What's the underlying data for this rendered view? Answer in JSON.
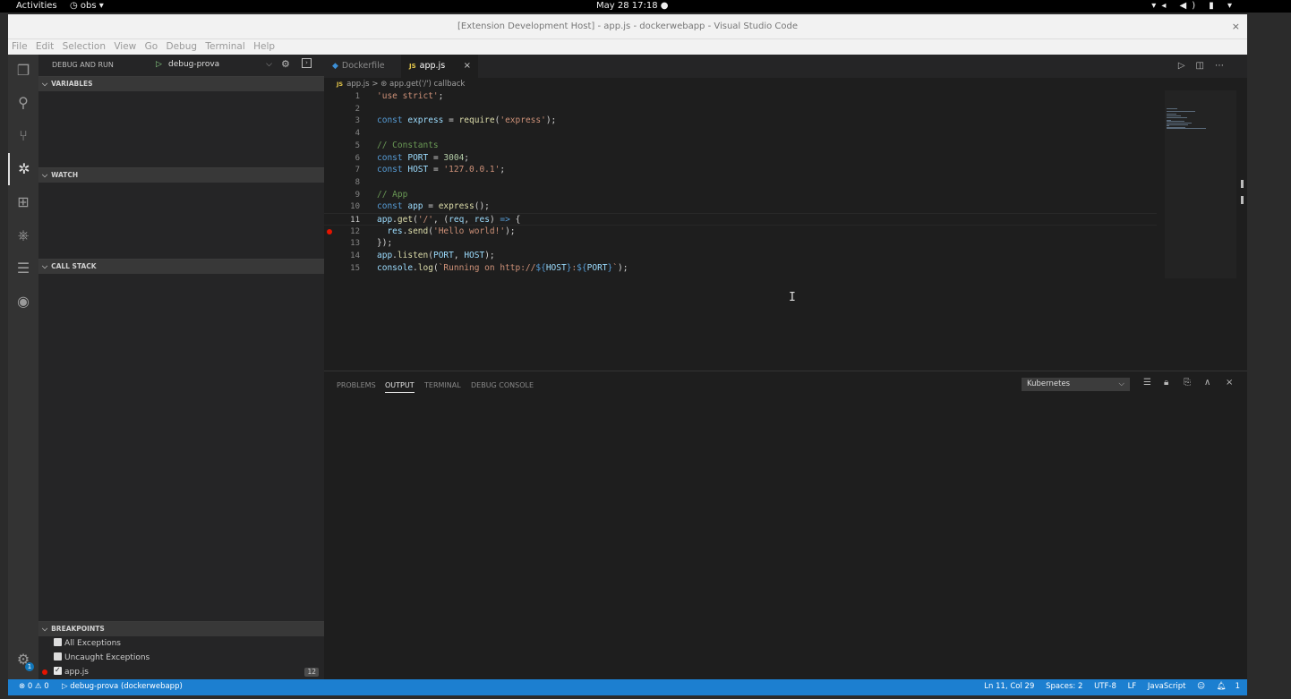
{
  "gnome": {
    "activities": "Activities",
    "app_menu": "obs ▾",
    "clock": "May 28  17:18 ●",
    "tray": "▾◂ ◀) ▮ ▾"
  },
  "window": {
    "title": "[Extension Development Host] - app.js - dockerwebapp - Visual Studio Code",
    "close": "×"
  },
  "menu": [
    "File",
    "Edit",
    "Selection",
    "View",
    "Go",
    "Debug",
    "Terminal",
    "Help"
  ],
  "activitybar": {
    "settings_badge": "1"
  },
  "sidebar": {
    "title": "DEBUG AND RUN",
    "config": "debug-prova",
    "sections": {
      "variables": "VARIABLES",
      "watch": "WATCH",
      "callstack": "CALL STACK",
      "breakpoints": "BREAKPOINTS"
    },
    "breakpoints": [
      {
        "label": "All Exceptions",
        "checked": false
      },
      {
        "label": "Uncaught Exceptions",
        "checked": false
      },
      {
        "label": "app.js",
        "checked": true,
        "count": "12"
      }
    ]
  },
  "tabs": [
    {
      "label": "Dockerfile",
      "icon": "docker-icon",
      "active": false
    },
    {
      "label": "app.js",
      "icon": "js-icon",
      "active": true
    }
  ],
  "breadcrumb": {
    "file": "app.js",
    "icon_label": "JS",
    "sep": ">",
    "symbol": "app.get('/') callback"
  },
  "code": [
    {
      "n": "1",
      "html": "<span class='str'>'use strict'</span>;"
    },
    {
      "n": "2",
      "html": ""
    },
    {
      "n": "3",
      "html": "<span class='kw'>const</span> <span class='var'>express</span> = <span class='fn'>require</span>(<span class='str'>'express'</span>);"
    },
    {
      "n": "4",
      "html": ""
    },
    {
      "n": "5",
      "html": "<span class='cm'>// Constants</span>"
    },
    {
      "n": "6",
      "html": "<span class='kw'>const</span> <span class='var'>PORT</span> = <span class='num'>3004</span>;"
    },
    {
      "n": "7",
      "html": "<span class='kw'>const</span> <span class='var'>HOST</span> = <span class='str'>'127.0.0.1'</span>;"
    },
    {
      "n": "8",
      "html": ""
    },
    {
      "n": "9",
      "html": "<span class='cm'>// App</span>"
    },
    {
      "n": "10",
      "html": "<span class='kw'>const</span> <span class='var'>app</span> = <span class='fn'>express</span>();"
    },
    {
      "n": "11",
      "html": "<span class='var'>app</span>.<span class='fn'>get</span>(<span class='str'>'/'</span>, (<span class='var'>req</span>, <span class='var'>res</span>) <span class='kw'>=&gt;</span> {",
      "current": true
    },
    {
      "n": "12",
      "html": "  <span class='var'>res</span>.<span class='fn'>send</span>(<span class='str'>'Hello world!'</span>);",
      "breakpoint": true
    },
    {
      "n": "13",
      "html": "});"
    },
    {
      "n": "14",
      "html": "<span class='var'>app</span>.<span class='fn'>listen</span>(<span class='var'>PORT</span>, <span class='var'>HOST</span>);"
    },
    {
      "n": "15",
      "html": "<span class='var'>console</span>.<span class='fn'>log</span>(<span class='str'>`Running on http://</span><span class='kw'>${</span><span class='var'>HOST</span><span class='kw'>}</span><span class='str'>:</span><span class='kw'>${</span><span class='var'>PORT</span><span class='kw'>}</span><span class='str'>`</span>);"
    }
  ],
  "panel": {
    "tabs": [
      {
        "label": "PROBLEMS",
        "active": false
      },
      {
        "label": "OUTPUT",
        "active": true
      },
      {
        "label": "TERMINAL",
        "active": false
      },
      {
        "label": "DEBUG CONSOLE",
        "active": false
      }
    ],
    "output_channel": "Kubernetes"
  },
  "status": {
    "problems": "⊗ 0  ⚠ 0",
    "debug": "▷ debug-prova (dockerwebapp)",
    "position": "Ln 11, Col 29",
    "spaces": "Spaces: 2",
    "encoding": "UTF-8",
    "eol": "LF",
    "language": "JavaScript",
    "notifications": "1"
  }
}
